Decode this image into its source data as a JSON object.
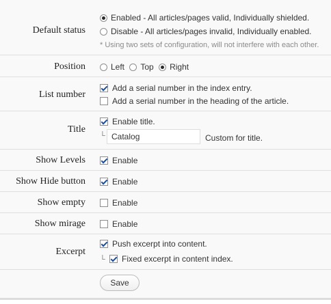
{
  "default_status": {
    "label": "Default status",
    "enabled_text": "Enabled - All articles/pages valid, Individually shielded.",
    "disable_text": "Disable - All articles/pages invalid, Individually enabled.",
    "note": "* Using two sets of configuration, will not interfere with each other."
  },
  "position": {
    "label": "Position",
    "options": [
      "Left",
      "Top",
      "Right"
    ],
    "selected": "Right"
  },
  "list_number": {
    "label": "List number",
    "opt1": "Add a serial number in the index entry.",
    "opt2": "Add a serial number in the heading of the article."
  },
  "title": {
    "label": "Title",
    "enable_text": "Enable title.",
    "input_value": "Catalog",
    "custom_text": "Custom for title."
  },
  "show_levels": {
    "label": "Show Levels",
    "enable_text": "Enable"
  },
  "show_hide": {
    "label": "Show Hide button",
    "enable_text": "Enable"
  },
  "show_empty": {
    "label": "Show empty",
    "enable_text": "Enable"
  },
  "show_mirage": {
    "label": "Show mirage",
    "enable_text": "Enable"
  },
  "excerpt": {
    "label": "Excerpt",
    "push_text": "Push excerpt into content.",
    "fixed_text": "Fixed excerpt in content index."
  },
  "save_label": "Save",
  "tree_glyph": "└"
}
